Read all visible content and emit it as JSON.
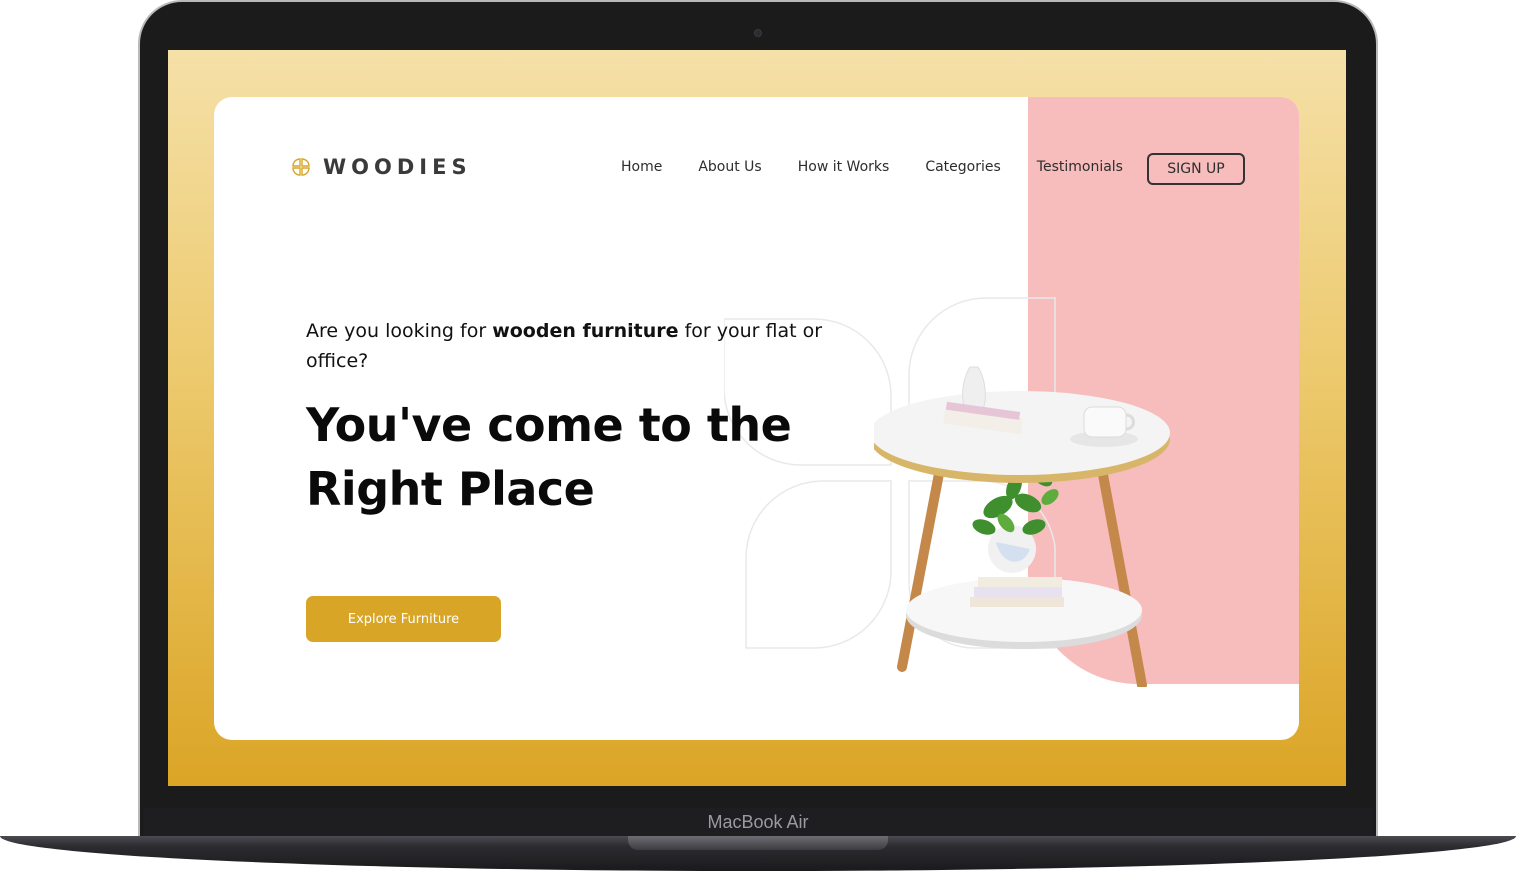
{
  "device": {
    "label": "MacBook Air"
  },
  "site": {
    "brand": "WOODIES",
    "nav": [
      {
        "label": "Home"
      },
      {
        "label": "About Us"
      },
      {
        "label": "How it Works"
      },
      {
        "label": "Categories"
      },
      {
        "label": "Testimonials"
      }
    ],
    "signup_label": "SIGN UP",
    "hero": {
      "lead_prefix": "Are you looking for ",
      "lead_bold": "wooden furniture",
      "lead_suffix": " for your flat or office?",
      "headline_line1": "You've come to the",
      "headline_line2": "Right Place",
      "cta_label": "Explore Furniture"
    }
  },
  "colors": {
    "accent": "#d8a526",
    "pink": "#f7bcbc",
    "text": "#0a0a0a"
  },
  "icons": [
    "logo-flower-icon"
  ]
}
